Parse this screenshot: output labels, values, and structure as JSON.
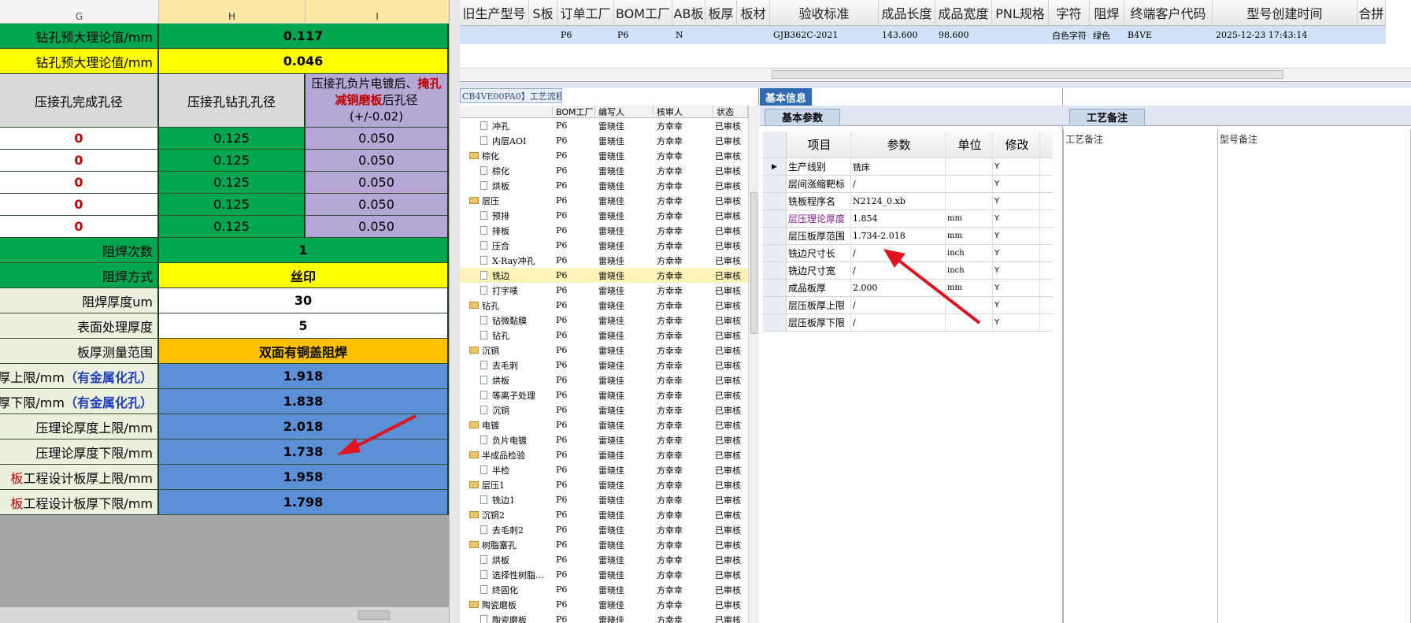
{
  "excel": {
    "columns": [
      {
        "label": "G",
        "selected": false
      },
      {
        "label": "H",
        "selected": true
      },
      {
        "label": "I",
        "selected": true
      }
    ],
    "rows": [
      {
        "label": "钻孔预大理论值/mm",
        "value": "0.117",
        "fill": "green"
      },
      {
        "label": "钻孔预大理论值/mm",
        "value": "0.046",
        "fill": "yellow"
      },
      {
        "type": "header",
        "g": "压接孔完成孔径",
        "h": "压接孔钻孔孔径",
        "i1": "压接孔负片电镀后、",
        "i2": "掩孔",
        "i3": "减铜磨板",
        "i4": "后孔径",
        "i5": "(+/-0.02)"
      },
      {
        "type": "data",
        "g": "0",
        "h": "0.125",
        "i": "0.050"
      },
      {
        "type": "data",
        "g": "0",
        "h": "0.125",
        "i": "0.050"
      },
      {
        "type": "data",
        "g": "0",
        "h": "0.125",
        "i": "0.050"
      },
      {
        "type": "data",
        "g": "0",
        "h": "0.125",
        "i": "0.050"
      },
      {
        "type": "data",
        "g": "0",
        "h": "0.125",
        "i": "0.050"
      },
      {
        "label": "阻焊次数",
        "value": "1",
        "fill": "green"
      },
      {
        "label": "阻焊方式",
        "value": "丝印",
        "fill": "yellow"
      },
      {
        "label": "阻焊厚度um",
        "value": "30",
        "fill": "white"
      },
      {
        "label": "表面处理厚度",
        "value": "5",
        "fill": "white"
      },
      {
        "label": "板厚测量范围",
        "value": "双面有铜盖阻焊",
        "fill": "orange"
      },
      {
        "label": "板厚上限/mm",
        "label_extra": "（有金属化孔）",
        "value": "1.918",
        "fill": "blue"
      },
      {
        "label": "板厚下限/mm",
        "label_extra": "（有金属化孔）",
        "value": "1.838",
        "fill": "blue"
      },
      {
        "label": "压理论厚度上限/mm",
        "value": "2.018",
        "fill": "blue"
      },
      {
        "label": "压理论厚度下限/mm",
        "value": "1.738",
        "fill": "blue"
      },
      {
        "label": "工程设计板厚上限/mm",
        "label_prefix": "板",
        "value": "1.958",
        "fill": "blue"
      },
      {
        "label": "工程设计板厚下限/mm",
        "label_prefix": "板",
        "value": "1.798",
        "fill": "blue"
      }
    ]
  },
  "top_grid": {
    "headers": [
      "旧生产型号",
      "S板",
      "订单工厂",
      "BOM工厂",
      "AB板",
      "板厚",
      "板材",
      "验收标准",
      "成品长度",
      "成品宽度",
      "PNL规格",
      "字符",
      "阻焊",
      "终端客户代码",
      "型号创建时间",
      "合拼"
    ],
    "row": [
      "",
      "",
      "P6",
      "P6",
      "N",
      "",
      "",
      "GJB362C-2021",
      "143.600",
      "98.600",
      "",
      "白色字符",
      "绿色",
      "B4VE",
      "2025-12-23 17:43:14",
      ""
    ]
  },
  "tree": {
    "tab": "CB4VE00PA0】工艺流程",
    "headers": [
      "",
      "BOM工厂",
      "编写人",
      "核审人",
      "状态"
    ],
    "rows": [
      {
        "kind": "doc",
        "name": "冲孔",
        "f": "P6",
        "w": "雷晓佳",
        "a": "方幸幸",
        "s": "已审核"
      },
      {
        "kind": "doc",
        "name": "内层AOI",
        "f": "P6",
        "w": "雷晓佳",
        "a": "方幸幸",
        "s": "已审核"
      },
      {
        "kind": "folder",
        "name": "棕化",
        "f": "P6",
        "w": "雷晓佳",
        "a": "方幸幸",
        "s": "已审核"
      },
      {
        "kind": "doc",
        "name": "棕化",
        "f": "P6",
        "w": "雷晓佳",
        "a": "方幸幸",
        "s": "已审核"
      },
      {
        "kind": "doc",
        "name": "烘板",
        "f": "P6",
        "w": "雷晓佳",
        "a": "方幸幸",
        "s": "已审核"
      },
      {
        "kind": "folder",
        "name": "层压",
        "f": "P6",
        "w": "雷晓佳",
        "a": "方幸幸",
        "s": "已审核"
      },
      {
        "kind": "doc",
        "name": "预排",
        "f": "P6",
        "w": "雷晓佳",
        "a": "方幸幸",
        "s": "已审核"
      },
      {
        "kind": "doc",
        "name": "排板",
        "f": "P6",
        "w": "雷晓佳",
        "a": "方幸幸",
        "s": "已审核"
      },
      {
        "kind": "doc",
        "name": "压合",
        "f": "P6",
        "w": "雷晓佳",
        "a": "方幸幸",
        "s": "已审核"
      },
      {
        "kind": "doc",
        "name": "X-Ray冲孔",
        "f": "P6",
        "w": "雷晓佳",
        "a": "方幸幸",
        "s": "已审核"
      },
      {
        "kind": "doc",
        "name": "铣边",
        "f": "P6",
        "w": "雷晓佳",
        "a": "方幸幸",
        "s": "已审核",
        "selected": true
      },
      {
        "kind": "doc",
        "name": "打字唛",
        "f": "P6",
        "w": "雷晓佳",
        "a": "方幸幸",
        "s": "已审核"
      },
      {
        "kind": "folder",
        "name": "钻孔",
        "f": "P6",
        "w": "雷晓佳",
        "a": "方幸幸",
        "s": "已审核"
      },
      {
        "kind": "doc",
        "name": "钻微黏膜",
        "f": "P6",
        "w": "雷晓佳",
        "a": "方幸幸",
        "s": "已审核"
      },
      {
        "kind": "doc",
        "name": "钻孔",
        "f": "P6",
        "w": "雷晓佳",
        "a": "方幸幸",
        "s": "已审核"
      },
      {
        "kind": "folder",
        "name": "沉铜",
        "f": "P6",
        "w": "雷晓佳",
        "a": "方幸幸",
        "s": "已审核"
      },
      {
        "kind": "doc",
        "name": "去毛刺",
        "f": "P6",
        "w": "雷晓佳",
        "a": "方幸幸",
        "s": "已审核"
      },
      {
        "kind": "doc",
        "name": "烘板",
        "f": "P6",
        "w": "雷晓佳",
        "a": "方幸幸",
        "s": "已审核"
      },
      {
        "kind": "doc",
        "name": "等离子处理",
        "f": "P6",
        "w": "雷晓佳",
        "a": "方幸幸",
        "s": "已审核"
      },
      {
        "kind": "doc",
        "name": "沉铜",
        "f": "P6",
        "w": "雷晓佳",
        "a": "方幸幸",
        "s": "已审核"
      },
      {
        "kind": "folder",
        "name": "电镀",
        "f": "P6",
        "w": "雷晓佳",
        "a": "方幸幸",
        "s": "已审核"
      },
      {
        "kind": "doc",
        "name": "负片电镀",
        "f": "P6",
        "w": "雷晓佳",
        "a": "方幸幸",
        "s": "已审核"
      },
      {
        "kind": "folder",
        "name": "半成品检验",
        "f": "P6",
        "w": "雷晓佳",
        "a": "方幸幸",
        "s": "已审核"
      },
      {
        "kind": "doc",
        "name": "半检",
        "f": "P6",
        "w": "雷晓佳",
        "a": "方幸幸",
        "s": "已审核"
      },
      {
        "kind": "folder",
        "name": "层压1",
        "f": "P6",
        "w": "雷晓佳",
        "a": "方幸幸",
        "s": "已审核"
      },
      {
        "kind": "doc",
        "name": "铣边1",
        "f": "P6",
        "w": "雷晓佳",
        "a": "方幸幸",
        "s": "已审核"
      },
      {
        "kind": "folder",
        "name": "沉铜2",
        "f": "P6",
        "w": "雷晓佳",
        "a": "方幸幸",
        "s": "已审核"
      },
      {
        "kind": "doc",
        "name": "去毛刺2",
        "f": "P6",
        "w": "雷晓佳",
        "a": "方幸幸",
        "s": "已审核"
      },
      {
        "kind": "folder",
        "name": "树脂塞孔",
        "f": "P6",
        "w": "雷晓佳",
        "a": "方幸幸",
        "s": "已审核"
      },
      {
        "kind": "doc",
        "name": "烘板",
        "f": "P6",
        "w": "雷晓佳",
        "a": "方幸幸",
        "s": "已审核"
      },
      {
        "kind": "doc",
        "name": "选择性树脂…",
        "f": "P6",
        "w": "雷晓佳",
        "a": "方幸幸",
        "s": "已审核"
      },
      {
        "kind": "doc",
        "name": "终固化",
        "f": "P6",
        "w": "雷晓佳",
        "a": "方幸幸",
        "s": "已审核"
      },
      {
        "kind": "folder",
        "name": "陶瓷磨板",
        "f": "P6",
        "w": "雷晓佳",
        "a": "方幸幸",
        "s": "已审核"
      },
      {
        "kind": "doc",
        "name": "陶瓷磨板",
        "f": "P6",
        "w": "雷晓佳",
        "a": "方幸幸",
        "s": "已审核"
      }
    ]
  },
  "basic": {
    "tab": "基本信息",
    "subtab": "基本参数",
    "headers": [
      "项目",
      "参数",
      "单位",
      "修改"
    ],
    "rows": [
      {
        "item": "生产线别",
        "param": "铣床",
        "unit": "",
        "mod": "Y",
        "current": true
      },
      {
        "item": "层间涨缩靶标",
        "param": "/",
        "unit": "",
        "mod": "Y"
      },
      {
        "item": "铣板程序名",
        "param": "N2124_0.xb",
        "unit": "",
        "mod": "Y"
      },
      {
        "item": "层压理论厚度",
        "param": "1.854",
        "unit": "mm",
        "mod": "Y",
        "purple": true
      },
      {
        "item": "层压板厚范围",
        "param": "1.734-2.018",
        "unit": "mm",
        "mod": "Y"
      },
      {
        "item": "铣边尺寸长",
        "param": "/",
        "unit": "inch",
        "mod": "Y"
      },
      {
        "item": "铣边尺寸宽",
        "param": "/",
        "unit": "inch",
        "mod": "Y"
      },
      {
        "item": "成品板厚",
        "param": "2.000",
        "unit": "mm",
        "mod": "Y"
      },
      {
        "item": "层压板厚上限",
        "param": "/",
        "unit": "",
        "mod": "Y"
      },
      {
        "item": "层压板厚下限",
        "param": "/",
        "unit": "",
        "mod": "Y"
      }
    ]
  },
  "remark": {
    "tab": "工艺备注",
    "col1": "工艺备注",
    "col2": "型号备注"
  },
  "colors": {
    "arrow": "#e0141e",
    "accent": "#2f6ab4"
  }
}
